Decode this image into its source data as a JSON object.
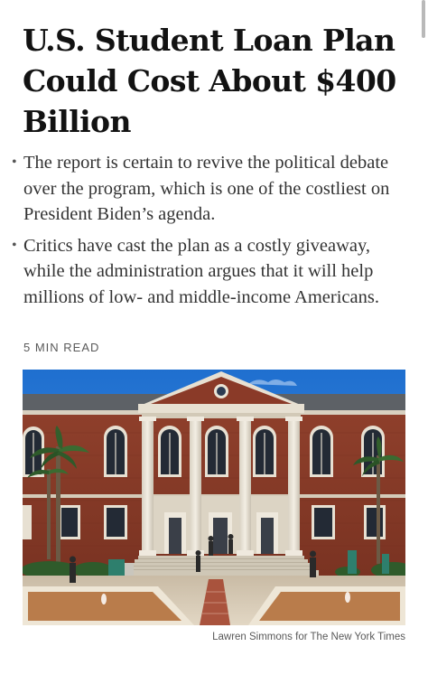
{
  "article": {
    "headline": "U.S. Student Loan Plan Could Cost About $400 Billion",
    "summary": [
      "The report is certain to revive the political debate over the program, which is one of the costliest on President Biden’s agenda.",
      "Critics have cast the plan as a costly giveaway, while the administration argues that it will help millions of low- and middle-income Americans."
    ],
    "bullet_glyph": "•",
    "read_time": "5 MIN READ",
    "image": {
      "credit": "Lawren Simmons for The New York Times"
    }
  }
}
